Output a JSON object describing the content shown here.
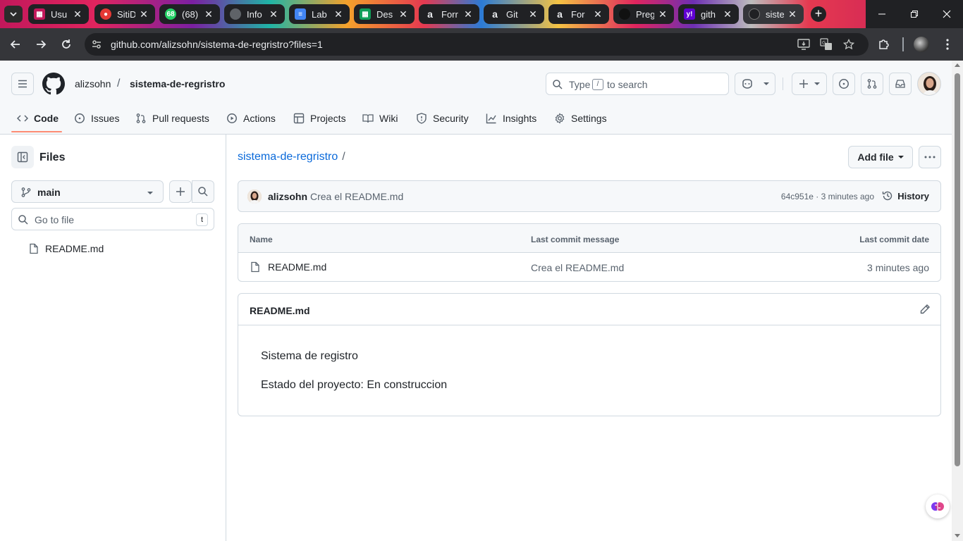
{
  "browser": {
    "tabs": [
      {
        "title": "Usu",
        "icon": "sheets-icon",
        "color": "#c2185b"
      },
      {
        "title": "SitiD",
        "icon": "red-icon",
        "color": "#e53935"
      },
      {
        "title": "(68)",
        "icon": "whatsapp-icon",
        "color": "#25d366"
      },
      {
        "title": "Info",
        "icon": "github-icon",
        "color": "#9aa0a6"
      },
      {
        "title": "Lab",
        "icon": "docs-icon",
        "color": "#4285f4"
      },
      {
        "title": "Des",
        "icon": "sheets-icon",
        "color": "#0f9d58"
      },
      {
        "title": "Forr",
        "icon": "amazon-icon",
        "color": "#e8eaed"
      },
      {
        "title": "Git",
        "icon": "amazon-icon",
        "color": "#e8eaed"
      },
      {
        "title": "For",
        "icon": "amazon-icon",
        "color": "#e8eaed"
      },
      {
        "title": "Preg",
        "icon": "openai-icon",
        "color": "#202124"
      },
      {
        "title": "gith",
        "icon": "yahoo-icon",
        "color": "#6001d2"
      },
      {
        "title": "siste",
        "icon": "github-icon",
        "color": "#e8eaed"
      }
    ],
    "url": "github.com/alizsohn/sistema-de-regristro?files=1"
  },
  "header": {
    "owner": "alizsohn",
    "separator": "/",
    "repo": "sistema-de-regristro",
    "search": {
      "prefix": "Type",
      "key": "/",
      "suffix": "to search"
    }
  },
  "nav": {
    "items": [
      {
        "label": "Code",
        "icon": "code-icon"
      },
      {
        "label": "Issues",
        "icon": "issue-icon"
      },
      {
        "label": "Pull requests",
        "icon": "pull-request-icon"
      },
      {
        "label": "Actions",
        "icon": "play-icon"
      },
      {
        "label": "Projects",
        "icon": "table-icon"
      },
      {
        "label": "Wiki",
        "icon": "book-icon"
      },
      {
        "label": "Security",
        "icon": "shield-icon"
      },
      {
        "label": "Insights",
        "icon": "graph-icon"
      },
      {
        "label": "Settings",
        "icon": "gear-icon"
      }
    ]
  },
  "sidebar": {
    "title": "Files",
    "branch": "main",
    "goto_placeholder": "Go to file",
    "goto_key": "t",
    "files": [
      "README.md"
    ]
  },
  "main": {
    "breadcrumb": {
      "repo": "sistema-de-regristro",
      "sep": "/"
    },
    "add_file": "Add file",
    "commit": {
      "author": "alizsohn",
      "message": "Crea el README.md",
      "meta": "64c951e · 3 minutes ago",
      "history": "History"
    },
    "table": {
      "headers": [
        "Name",
        "Last commit message",
        "Last commit date"
      ],
      "rows": [
        {
          "name": "README.md",
          "message": "Crea el README.md",
          "date": "3 minutes ago"
        }
      ]
    },
    "readme": {
      "title": "README.md",
      "lines": [
        "Sistema de registro",
        "Estado del proyecto: En construccion"
      ]
    }
  }
}
